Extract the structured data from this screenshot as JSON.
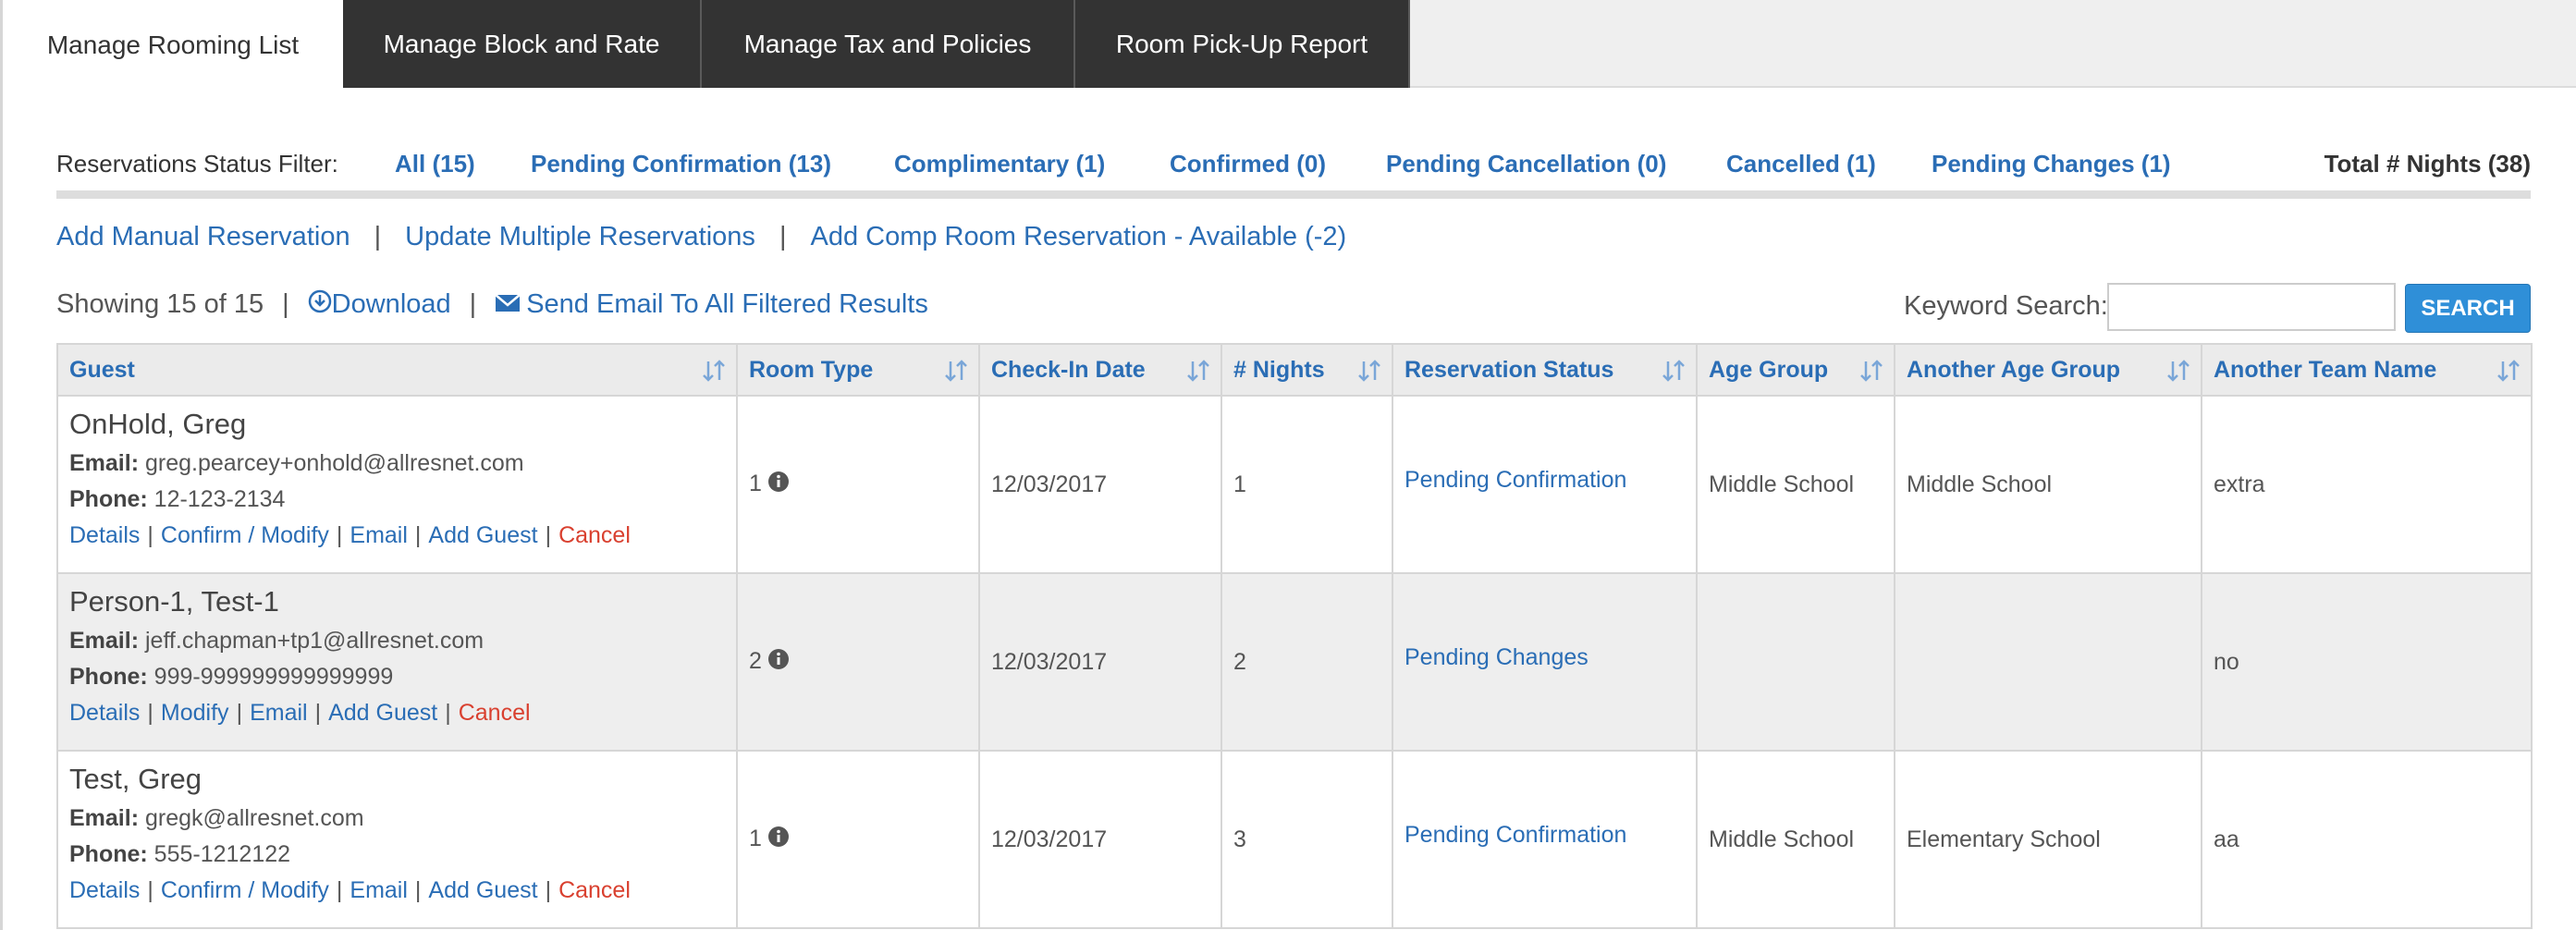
{
  "tabs": [
    {
      "label": "Manage Rooming List",
      "active": true
    },
    {
      "label": "Manage Block and Rate",
      "active": false
    },
    {
      "label": "Manage Tax and Policies",
      "active": false
    },
    {
      "label": "Room Pick-Up Report",
      "active": false
    }
  ],
  "filter": {
    "label": "Reservations Status Filter:",
    "items": [
      {
        "label": "All (15)"
      },
      {
        "label": "Pending Confirmation (13)"
      },
      {
        "label": "Complimentary (1)"
      },
      {
        "label": "Confirmed (0)"
      },
      {
        "label": "Pending Cancellation (0)"
      },
      {
        "label": "Cancelled (1)"
      },
      {
        "label": "Pending Changes (1)"
      }
    ],
    "total": "Total # Nights (38)"
  },
  "actions": {
    "add_manual": "Add Manual Reservation",
    "update_multiple": "Update Multiple Reservations",
    "add_comp": "Add Comp Room Reservation - Available (-2)",
    "separator": "|"
  },
  "results": {
    "showing": "Showing 15 of 15",
    "download": "Download",
    "send_email": "Send Email To All Filtered Results",
    "separator": "|"
  },
  "search": {
    "label": "Keyword Search:",
    "value": "",
    "button": "SEARCH"
  },
  "table": {
    "columns": [
      "Guest",
      "Room Type",
      "Check-In Date",
      "# Nights",
      "Reservation Status",
      "Age Group",
      "Another Age Group",
      "Another Team Name"
    ],
    "rows": [
      {
        "name": "OnHold, Greg",
        "email_label": "Email:",
        "email": "greg.pearcey+onhold@allresnet.com",
        "phone_label": "Phone:",
        "phone": "12-123-2134",
        "links": [
          "Details",
          "Confirm / Modify",
          "Email",
          "Add Guest",
          "Cancel"
        ],
        "room_type": "1",
        "checkin": "12/03/2017",
        "nights": "1",
        "status": "Pending Confirmation",
        "age_group": "Middle School",
        "another_age_group": "Middle School",
        "team": "extra"
      },
      {
        "name": "Person-1, Test-1",
        "email_label": "Email:",
        "email": "jeff.chapman+tp1@allresnet.com",
        "phone_label": "Phone:",
        "phone": "999-999999999999999",
        "links": [
          "Details",
          "Modify",
          "Email",
          "Add Guest",
          "Cancel"
        ],
        "room_type": "2",
        "checkin": "12/03/2017",
        "nights": "2",
        "status": "Pending Changes",
        "age_group": "",
        "another_age_group": "",
        "team": "no"
      },
      {
        "name": "Test, Greg",
        "email_label": "Email:",
        "email": "gregk@allresnet.com",
        "phone_label": "Phone:",
        "phone": "555-1212122",
        "links": [
          "Details",
          "Confirm / Modify",
          "Email",
          "Add Guest",
          "Cancel"
        ],
        "room_type": "1",
        "checkin": "12/03/2017",
        "nights": "3",
        "status": "Pending Confirmation",
        "age_group": "Middle School",
        "another_age_group": "Elementary School",
        "team": "aa"
      }
    ]
  },
  "colors": {
    "link": "#2a6db5",
    "cancel": "#d9402f",
    "tab_dark": "#333333",
    "search_button": "#2f8fd8"
  }
}
